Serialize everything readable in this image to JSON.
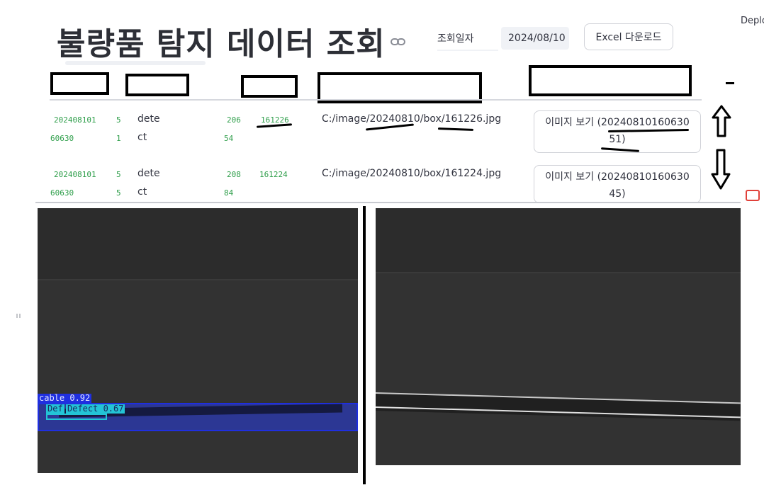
{
  "header": {
    "title": "불량품 탐지 데이터 조회",
    "deploy_label": "Deplo"
  },
  "filters": {
    "date_label": "조회일자",
    "date_value": "2024/08/10",
    "excel_button": "Excel 다운로드"
  },
  "table": {
    "rows": [
      {
        "id_line1": "202408101",
        "id_line2": "60630",
        "col2_line1": "5",
        "col2_line2": "1",
        "type_line1": "dete",
        "type_line2": "ct",
        "num_line1": "206",
        "num_line2": "54",
        "code": "161226",
        "path": "C:/image/20240810/box/161226.jpg",
        "button_line1": "이미지 보기 (20240810160630",
        "button_line2": "51)"
      },
      {
        "id_line1": "202408101",
        "id_line2": "60630",
        "col2_line1": "5",
        "col2_line2": "5",
        "type_line1": "dete",
        "type_line2": "ct",
        "num_line1": "208",
        "num_line2": "84",
        "code": "161224",
        "path": "C:/image/20240810/box/161224.jpg",
        "button_line1": "이미지 보기 (20240810160630",
        "button_line2": "45)"
      }
    ]
  },
  "detection": {
    "cable_label": "cable 0.92",
    "defect_label_overlap": "Def",
    "defect_label": "Defect 0.67"
  },
  "colors": {
    "accent_green": "#2e9e4a",
    "bbox_blue": "#1f2fe0",
    "bbox_cyan": "#23c4d6",
    "image_bg": "#303030"
  }
}
